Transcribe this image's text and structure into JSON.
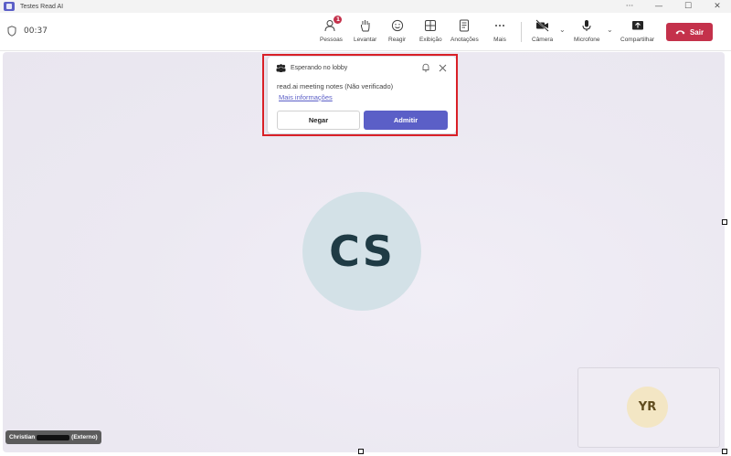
{
  "window": {
    "title": "Testes Read AI",
    "controls": [
      "···",
      "—",
      "☐",
      "✕"
    ]
  },
  "call": {
    "timer": "00:37"
  },
  "toolbar": {
    "people": {
      "label": "Pessoas",
      "badge": "1",
      "icon": "people-icon"
    },
    "raise": {
      "label": "Levantar",
      "icon": "raise-hand-icon"
    },
    "react": {
      "label": "Reagir",
      "icon": "smiley-icon"
    },
    "view": {
      "label": "Exibição",
      "icon": "grid-view-icon"
    },
    "notes": {
      "label": "Anotações",
      "icon": "notes-icon"
    },
    "more": {
      "label": "Mais",
      "icon": "more-dots-icon"
    },
    "camera": {
      "label": "Câmera",
      "icon": "camera-off-icon"
    },
    "mic": {
      "label": "Microfone",
      "icon": "microphone-icon"
    },
    "share": {
      "label": "Compartilhar",
      "icon": "share-screen-icon"
    },
    "leave": {
      "label": "Sair",
      "color": "#c4314b"
    }
  },
  "lobby": {
    "title": "Esperando no lobby",
    "message": "read.ai meeting notes (Não verificado)",
    "link": "Mais informações",
    "deny_label": "Negar",
    "admit_label": "Admitir",
    "accent": "#5b5fc7"
  },
  "stage": {
    "main_initials": "CS",
    "name_first": "Christian",
    "name_suffix": "(Externo)",
    "self_initials": "YR"
  }
}
